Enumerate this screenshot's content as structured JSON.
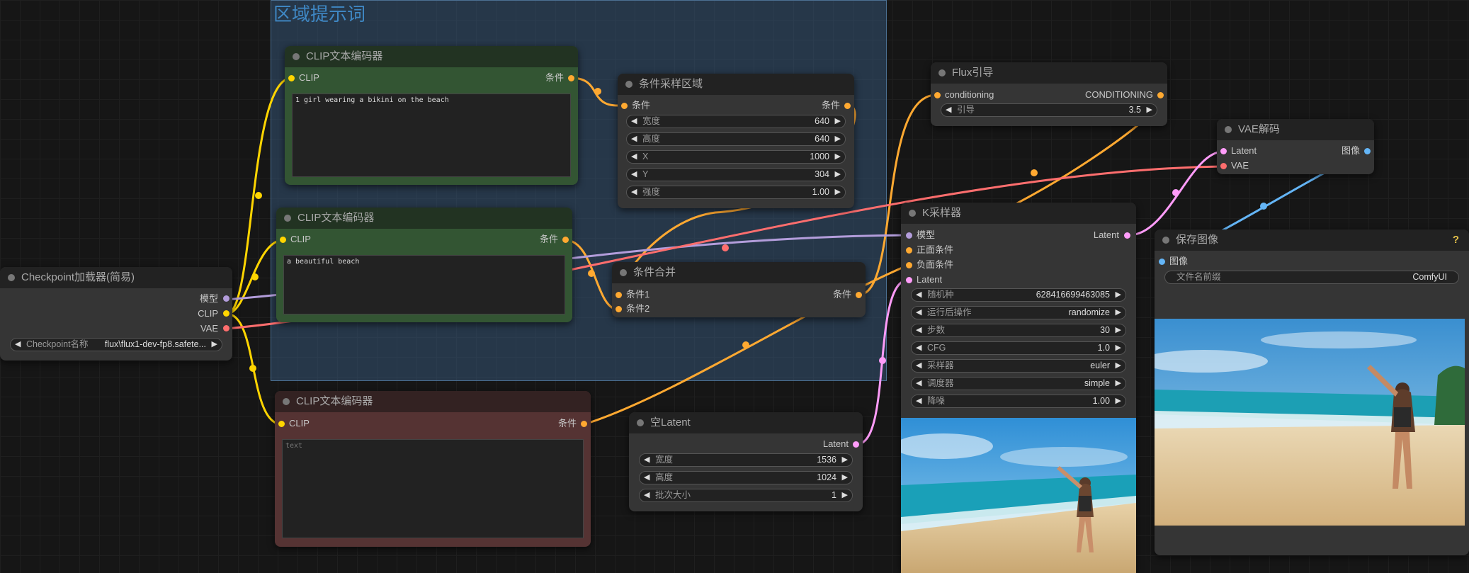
{
  "group": {
    "title": "区域提示词"
  },
  "checkpoint": {
    "title": "Checkpoint加载器(简易)",
    "out_model": "模型",
    "out_clip": "CLIP",
    "out_vae": "VAE",
    "ckpt_label": "Checkpoint名称",
    "ckpt_value": "flux\\flux1-dev-fp8.safete..."
  },
  "clip1": {
    "title": "CLIP文本编码器",
    "in": "CLIP",
    "out": "条件",
    "text": "1 girl wearing a bikini on the beach"
  },
  "clip2": {
    "title": "CLIP文本编码器",
    "in": "CLIP",
    "out": "条件",
    "text": "a beautiful beach"
  },
  "clip3": {
    "title": "CLIP文本编码器",
    "in": "CLIP",
    "out": "条件",
    "placeholder": "text"
  },
  "area": {
    "title": "条件采样区域",
    "in": "条件",
    "out": "条件",
    "width_label": "宽度",
    "width": "640",
    "height_label": "高度",
    "height": "640",
    "x_label": "X",
    "x": "1000",
    "y_label": "Y",
    "y": "304",
    "strength_label": "强度",
    "strength": "1.00"
  },
  "combine": {
    "title": "条件合并",
    "in1": "条件1",
    "in2": "条件2",
    "out": "条件"
  },
  "latent": {
    "title": "空Latent",
    "out": "Latent",
    "width_label": "宽度",
    "width": "1536",
    "height_label": "高度",
    "height": "1024",
    "batch_label": "批次大小",
    "batch": "1"
  },
  "flux": {
    "title": "Flux引导",
    "in": "conditioning",
    "out": "CONDITIONING",
    "guide_label": "引导",
    "guide": "3.5"
  },
  "ksampler": {
    "title": "K采样器",
    "in_model": "模型",
    "in_pos": "正面条件",
    "in_neg": "负面条件",
    "in_latent": "Latent",
    "out": "Latent",
    "seed_label": "随机种",
    "seed": "628416699463085",
    "after_label": "运行后操作",
    "after": "randomize",
    "steps_label": "步数",
    "steps": "30",
    "cfg_label": "CFG",
    "cfg": "1.0",
    "sampler_label": "采样器",
    "sampler": "euler",
    "scheduler_label": "调度器",
    "scheduler": "simple",
    "denoise_label": "降噪",
    "denoise": "1.00"
  },
  "vae": {
    "title": "VAE解码",
    "in_latent": "Latent",
    "in_vae": "VAE",
    "out": "图像"
  },
  "save": {
    "title": "保存图像",
    "in": "图像",
    "prefix_label": "文件名前缀",
    "prefix": "ComfyUI",
    "help": "?"
  },
  "colors": {
    "clip": "#ffd500",
    "cond": "#ffa931",
    "model": "#b39ddb",
    "vae": "#ff6e6e",
    "latent": "#ff9cf9",
    "image": "#64b5f6"
  }
}
